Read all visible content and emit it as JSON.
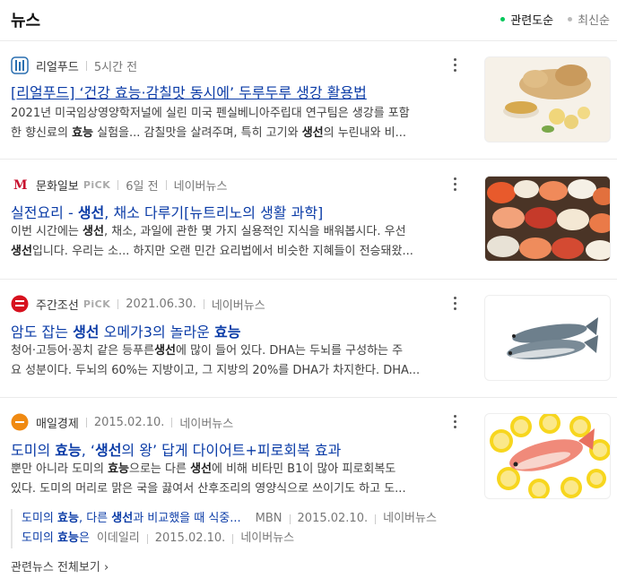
{
  "header": {
    "title": "뉴스",
    "sort_options": [
      {
        "label": "관련도순",
        "active": true
      },
      {
        "label": "최신순",
        "active": false
      }
    ]
  },
  "articles": [
    {
      "press": "리얼푸드",
      "press_logo": "realfood-logo",
      "pick": "",
      "time": "5시간 전",
      "source": "",
      "title_parts": [
        "[리얼푸드] ‘건강 효능·감칠맛 동시에’ 두루두루 생강 활용법"
      ],
      "desc_line1": "2021년 미국임상영양학저널에 실린 미국 펜실베니아주립대 연구팀은 생강를 포함",
      "desc_line2_parts": [
        "한 향신료의 ",
        "효능",
        " 실험을... 감칠맛을 살려주며, 특히 고기와 ",
        "생선",
        "의 누린내와 비..."
      ],
      "thumb": "ginger-image"
    },
    {
      "press": "문화일보",
      "press_logo": "munhwa-logo",
      "pick": "PiCK",
      "time": "6일 전",
      "source": "네이버뉴스",
      "title_parts": [
        "실전요리 - ",
        "생선",
        ", 채소 다루기[뉴트리노의 생활 과학]"
      ],
      "desc_line1_parts": [
        "이번 시간에는 ",
        "생선",
        ", 채소, 과일에 관한 몇 가지 실용적인 지식을 배워봅시다. 우선"
      ],
      "desc_line2_parts": [
        "생선",
        "입니다. 우리는 소... 하지만 오랜 민간 요리법에서 비슷한 지혜들이 전승돼왔..."
      ],
      "thumb": "sushi-image"
    },
    {
      "press": "주간조선",
      "press_logo": "weekly-chosun-logo",
      "pick": "PiCK",
      "time": "2021.06.30.",
      "source": "네이버뉴스",
      "title_parts": [
        "암도 잡는 ",
        "생선",
        " 오메가3의 놀라운 ",
        "효능"
      ],
      "desc_line1_parts": [
        "청어·고등어·꽁치 같은 등푸른",
        "생선",
        "에 많이 들어 있다. DHA는 두뇌를 구성하는 주"
      ],
      "desc_line2": "요 성분이다. 두뇌의 60%는 지방이고, 그 지방의 20%를 DHA가 차지한다. DHA...",
      "thumb": "mackerel-image"
    },
    {
      "press": "매일경제",
      "press_logo": "maeil-logo",
      "pick": "",
      "time": "2015.02.10.",
      "source": "네이버뉴스",
      "title_parts": [
        "도미의 ",
        "효능",
        ", ‘",
        "생선",
        "의 왕’ 답게 다이어트+피로회복 효과"
      ],
      "desc_line1_parts": [
        "뿐만 아니라 도미의 ",
        "효능",
        "으로는 다른 ",
        "생선",
        "에 비해 비타민 B1이 많아 피로회복도"
      ],
      "desc_line2": "있다. 도미의 머리로 맑은 국을 끓여서 산후조리의 영양식으로 쓰이기도 하고 도...",
      "thumb": "sea-bream-image"
    }
  ],
  "related": [
    {
      "title_parts": [
        "도미의 ",
        "효능",
        ", 다른 ",
        "생선",
        "과 비교했을 때 식중..."
      ],
      "press": "MBN",
      "time": "2015.02.10.",
      "source": "네이버뉴스"
    },
    {
      "title_parts": [
        "도미의 ",
        "효능",
        "은"
      ],
      "press": "이데일리",
      "time": "2015.02.10.",
      "source": "네이버뉴스"
    }
  ],
  "footer": {
    "label": "관련뉴스 전체보기",
    "arrow": "›"
  },
  "colors": {
    "accent": "#03c75a",
    "link": "#0b3ca7"
  }
}
